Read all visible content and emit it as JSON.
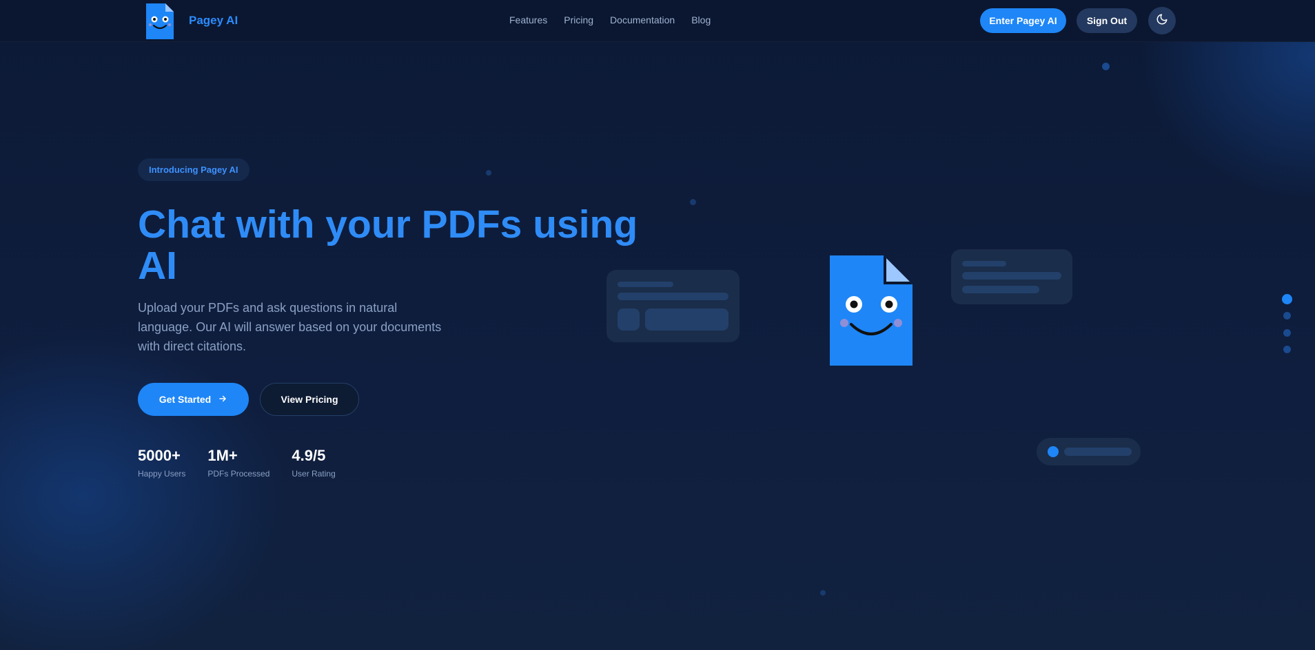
{
  "header": {
    "brand": "Pagey AI",
    "nav": [
      "Features",
      "Pricing",
      "Documentation",
      "Blog"
    ],
    "enter_label": "Enter Pagey AI",
    "signout_label": "Sign Out"
  },
  "hero": {
    "badge": "Introducing Pagey AI",
    "headline": "Chat with your PDFs using AI",
    "subtitle": "Upload your PDFs and ask questions in natural language. Our AI will answer based on your documents with direct citations.",
    "cta_primary": "Get Started",
    "cta_secondary": "View Pricing",
    "stats": [
      {
        "value": "5000+",
        "label": "Happy Users"
      },
      {
        "value": "1M+",
        "label": "PDFs Processed"
      },
      {
        "value": "4.9/5",
        "label": "User Rating"
      }
    ]
  },
  "icons": {
    "logo": "pdf-mascot-icon",
    "theme": "moon-icon",
    "arrow": "arrow-right-icon"
  },
  "colors": {
    "accent": "#1e86f7",
    "background": "#0d1a33",
    "secondary_button": "#23395f"
  }
}
